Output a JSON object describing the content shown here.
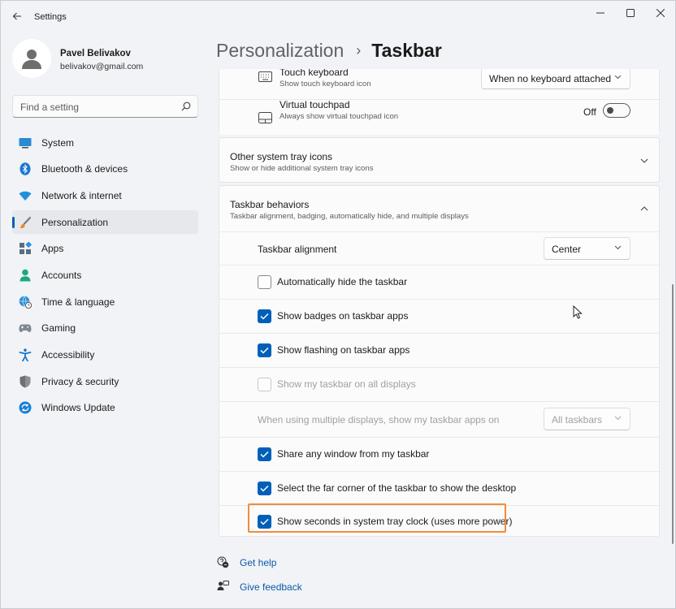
{
  "app": {
    "title": "Settings"
  },
  "user": {
    "name": "Pavel Belivakov",
    "email": "belivakov@gmail.com"
  },
  "search": {
    "placeholder": "Find a setting"
  },
  "nav": {
    "items": [
      {
        "label": "System",
        "icon": "monitor-icon"
      },
      {
        "label": "Bluetooth & devices",
        "icon": "bluetooth-icon"
      },
      {
        "label": "Network & internet",
        "icon": "wifi-icon"
      },
      {
        "label": "Personalization",
        "icon": "brush-icon",
        "active": true
      },
      {
        "label": "Apps",
        "icon": "apps-icon"
      },
      {
        "label": "Accounts",
        "icon": "person-icon"
      },
      {
        "label": "Time & language",
        "icon": "globe-clock-icon"
      },
      {
        "label": "Gaming",
        "icon": "gamepad-icon"
      },
      {
        "label": "Accessibility",
        "icon": "accessibility-icon"
      },
      {
        "label": "Privacy & security",
        "icon": "shield-icon"
      },
      {
        "label": "Windows Update",
        "icon": "refresh-icon"
      }
    ]
  },
  "header": {
    "parent": "Personalization",
    "separator": "›",
    "current": "Taskbar"
  },
  "corner_icons": {
    "touch_keyboard": {
      "title": "Touch keyboard",
      "subtitle": "Show touch keyboard icon",
      "value": "When no keyboard attached"
    },
    "virtual_touchpad": {
      "title": "Virtual touchpad",
      "subtitle": "Always show virtual touchpad icon",
      "state": "Off"
    }
  },
  "other_tray": {
    "title": "Other system tray icons",
    "subtitle": "Show or hide additional system tray icons"
  },
  "behaviors": {
    "title": "Taskbar behaviors",
    "subtitle": "Taskbar alignment, badging, automatically hide, and multiple displays",
    "alignment": {
      "label": "Taskbar alignment",
      "value": "Center"
    },
    "auto_hide": {
      "label": "Automatically hide the taskbar",
      "checked": false
    },
    "badges": {
      "label": "Show badges on taskbar apps",
      "checked": true
    },
    "flashing": {
      "label": "Show flashing on taskbar apps",
      "checked": true
    },
    "all_displays": {
      "label": "Show my taskbar on all displays",
      "checked": false,
      "disabled": true
    },
    "multi_display": {
      "label": "When using multiple displays, show my taskbar apps on",
      "value": "All taskbars",
      "disabled": true
    },
    "share_window": {
      "label": "Share any window from my taskbar",
      "checked": true
    },
    "far_corner": {
      "label": "Select the far corner of the taskbar to show the desktop",
      "checked": true
    },
    "seconds": {
      "label": "Show seconds in system tray clock (uses more power)",
      "checked": true
    }
  },
  "footer": {
    "help": "Get help",
    "feedback": "Give feedback"
  },
  "colors": {
    "accent": "#005fb8",
    "highlight": "#f28c3b",
    "link": "#0b5aa8"
  }
}
